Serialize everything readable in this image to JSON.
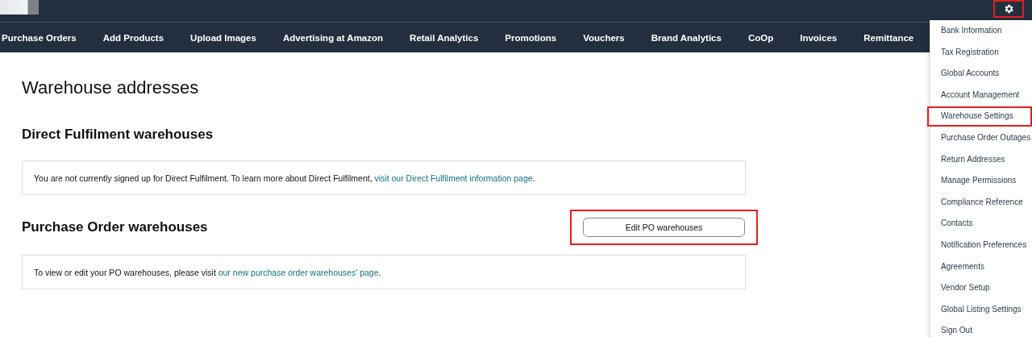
{
  "top_bar": {
    "settings_button": {
      "highlighted": true
    }
  },
  "nav": [
    {
      "label": "Purchase Orders"
    },
    {
      "label": "Add Products"
    },
    {
      "label": "Upload Images"
    },
    {
      "label": "Advertising at Amazon"
    },
    {
      "label": "Retail Analytics"
    },
    {
      "label": "Promotions"
    },
    {
      "label": "Vouchers"
    },
    {
      "label": "Brand Analytics"
    },
    {
      "label": "CoOp"
    },
    {
      "label": "Invoices"
    },
    {
      "label": "Remittance"
    }
  ],
  "settings_menu": [
    {
      "label": "Bank Information",
      "highlighted": false
    },
    {
      "label": "Tax Registration",
      "highlighted": false
    },
    {
      "label": "Global Accounts",
      "highlighted": false
    },
    {
      "label": "Account Management",
      "highlighted": false
    },
    {
      "label": "Warehouse Settings",
      "highlighted": true
    },
    {
      "label": "Purchase Order Outages",
      "highlighted": false
    },
    {
      "label": "Return Addresses",
      "highlighted": false
    },
    {
      "label": "Manage Permissions",
      "highlighted": false
    },
    {
      "label": "Compliance Reference",
      "highlighted": false
    },
    {
      "label": "Contacts",
      "highlighted": false
    },
    {
      "label": "Notification Preferences",
      "highlighted": false
    },
    {
      "label": "Agreements",
      "highlighted": false
    },
    {
      "label": "Vendor Setup",
      "highlighted": false
    },
    {
      "label": "Global Listing Settings",
      "highlighted": false
    },
    {
      "label": "Sign Out",
      "highlighted": false
    }
  ],
  "page": {
    "title": "Warehouse addresses",
    "sections": [
      {
        "heading": "Direct Fulfilment warehouses",
        "text": "You are not currently signed up for Direct Fulfilment. To learn more about Direct Fulfilment, ",
        "link": "visit our Direct Fulfilment information page",
        "after": "."
      },
      {
        "heading": "Purchase Order warehouses",
        "button": {
          "label": "Edit PO warehouses",
          "highlighted": true
        },
        "text": "To view or edit your PO warehouses, please visit ",
        "link": "our new purchase order warehouses' page",
        "after": "."
      }
    ]
  }
}
